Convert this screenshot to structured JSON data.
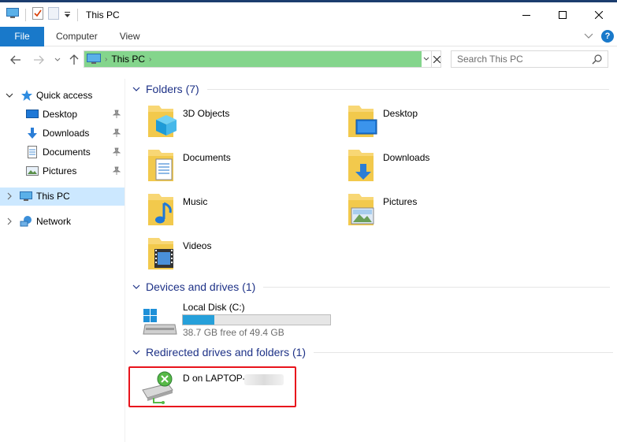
{
  "window": {
    "title": "This PC",
    "controls": [
      "minimize-icon",
      "maximize-icon",
      "close-icon"
    ]
  },
  "ribbon": {
    "tabs": [
      {
        "label": "File"
      },
      {
        "label": "Computer"
      },
      {
        "label": "View"
      }
    ],
    "help": "?"
  },
  "navigation": {
    "breadcrumb": [
      "This PC"
    ]
  },
  "search": {
    "placeholder": "Search This PC"
  },
  "sidebar": {
    "quick_access": "Quick access",
    "pinned": [
      {
        "label": "Desktop"
      },
      {
        "label": "Downloads"
      },
      {
        "label": "Documents"
      },
      {
        "label": "Pictures"
      }
    ],
    "this_pc": "This PC",
    "network": "Network"
  },
  "content": {
    "folders": {
      "header": "Folders (7)",
      "items": [
        {
          "label": "3D Objects",
          "icon": "3d-objects-icon"
        },
        {
          "label": "Desktop",
          "icon": "desktop-folder-icon"
        },
        {
          "label": "Documents",
          "icon": "documents-folder-icon"
        },
        {
          "label": "Downloads",
          "icon": "downloads-folder-icon"
        },
        {
          "label": "Music",
          "icon": "music-folder-icon"
        },
        {
          "label": "Pictures",
          "icon": "pictures-folder-icon"
        },
        {
          "label": "Videos",
          "icon": "videos-folder-icon"
        }
      ]
    },
    "devices": {
      "header": "Devices and drives (1)",
      "drive": {
        "name": "Local Disk (C:)",
        "free_text": "38.7 GB free of 49.4 GB",
        "used_fraction": 0.216
      }
    },
    "redirected": {
      "header": "Redirected drives and folders (1)",
      "item": {
        "label": "D on LAPTOP-"
      }
    }
  },
  "colors": {
    "accent": "#1979ca",
    "header_text": "#1e3287",
    "selection": "#cce8ff",
    "address_highlight": "#84d58c",
    "drive_bar": "#26a0da",
    "highlight_box": "#e8141c"
  }
}
